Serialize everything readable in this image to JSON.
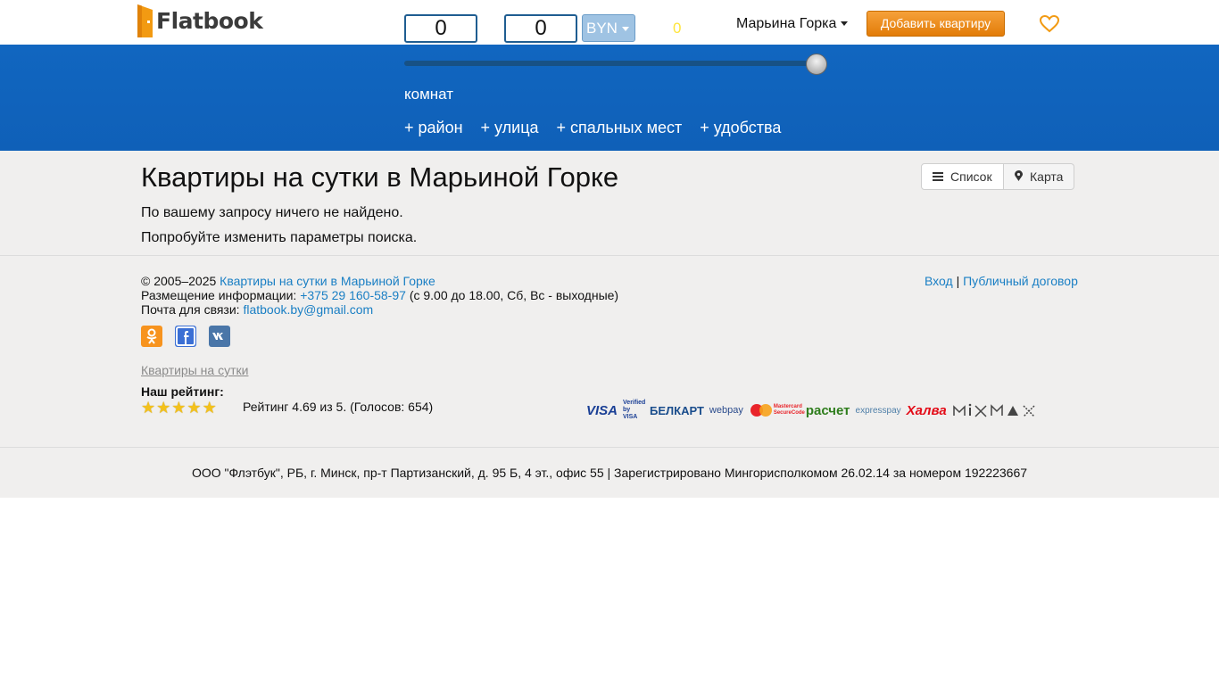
{
  "header": {
    "logo_text": "Flatbook",
    "price_min": "0",
    "price_max": "0",
    "currency": "BYN",
    "rooms_count": "0",
    "city": "Марьина Горка",
    "add_button": "Добавить квартиру"
  },
  "filters": {
    "rooms_label": "комнат",
    "items": [
      "+ район",
      "+ улица",
      "+ спальных мест",
      "+ удобства"
    ],
    "slider_value_fraction": 1.0
  },
  "main": {
    "title": "Квартиры на сутки в Марьиной Горке",
    "view_list": "Список",
    "view_map": "Карта",
    "message_1": "По вашему запросу ничего не найдено.",
    "message_2": "Попробуйте изменить параметры поиска."
  },
  "footer": {
    "copyright_prefix": "© 2005–2025",
    "copyright_link": "Квартиры на сутки в Марьиной Горке",
    "placement_label": "Размещение информации:",
    "phone": "+375 29 160-58-97",
    "hours": "(с 9.00 до 18.00, Сб, Вс - выходные)",
    "email_label": "Почта для связи:",
    "email": "flatbook.by@gmail.com",
    "login": "Вход",
    "separator": "|",
    "contract": "Публичный договор",
    "seo_link": "Квартиры на сутки",
    "rating_label": "Наш рейтинг:",
    "rating_text": "Рейтинг 4.69 из 5. (Голосов: 654)",
    "rating_stars": 5,
    "payments": [
      "VISA",
      "Verified by VISA",
      "БЕЛКАРТ",
      "webpay",
      "Mastercard SecureCode",
      "расчет",
      "expresspay",
      "Халва"
    ],
    "legal": "ООО \"Флэтбук\", РБ, г. Минск, пр-т Партизанский, д. 95 Б, 4 эт., офис 55 | Зарегистрировано Мингорисполкомом 26.02.14 за номером 192223667"
  },
  "colors": {
    "brand_blue": "#1166c0",
    "accent_orange": "#e27c08",
    "link": "#1a7fc4",
    "footer_bg": "#f0efee"
  }
}
